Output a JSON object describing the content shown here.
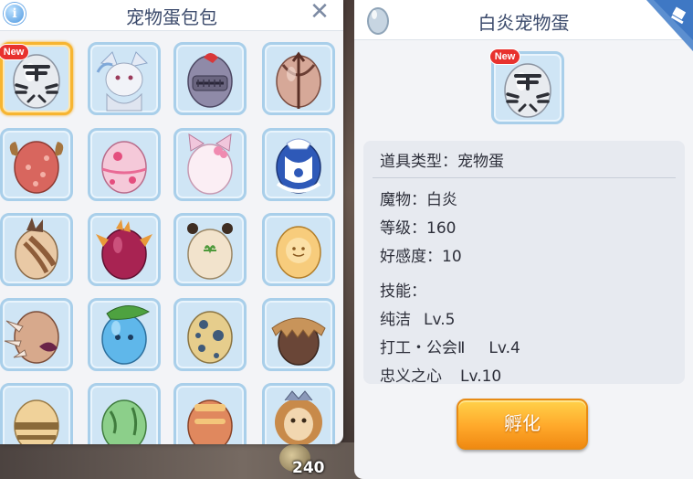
{
  "bag": {
    "title": "宠物蛋包包",
    "info_icon_text": "i",
    "close_icon": "close-icon",
    "new_label": "New",
    "slots": [
      {
        "name": "white-tiger-egg",
        "selected": true,
        "is_new": true
      },
      {
        "name": "fox-creature"
      },
      {
        "name": "knight-helmet-egg"
      },
      {
        "name": "arrow-egg"
      },
      {
        "name": "pink-flower-egg"
      },
      {
        "name": "sakura-egg"
      },
      {
        "name": "cat-ear-egg"
      },
      {
        "name": "blue-maid-egg"
      },
      {
        "name": "brown-spike-egg"
      },
      {
        "name": "red-dragon-egg"
      },
      {
        "name": "bear-sprout-egg"
      },
      {
        "name": "smiley-egg"
      },
      {
        "name": "horned-egg"
      },
      {
        "name": "blue-leaf-egg"
      },
      {
        "name": "spotted-egg"
      },
      {
        "name": "hair-egg"
      },
      {
        "name": "striped-egg"
      },
      {
        "name": "green-egg"
      },
      {
        "name": "red-pattern-egg"
      },
      {
        "name": "lion-creature"
      }
    ]
  },
  "background": {
    "number": "240"
  },
  "detail": {
    "title": "白炎宠物蛋",
    "new_label": "New",
    "item_type": "道具类型：宠物蛋",
    "monster": "魔物：白炎",
    "level": "等级：160",
    "affinity": "好感度：10",
    "skills_label": "技能：",
    "skills": [
      {
        "name": "纯洁",
        "level": "Lv.5"
      },
      {
        "name": "打工・公会Ⅱ",
        "level": "Lv.4"
      },
      {
        "name": "忠义之心",
        "level": "Lv.10"
      }
    ],
    "hatch_button": "孵化"
  },
  "colors": {
    "panel_bg": "#f3f4f7",
    "slot_bg": "#cfe5f5",
    "slot_border": "#a9cfea",
    "selected_border": "#f7b531",
    "title_text": "#3c4b6c",
    "new_badge": "#e8322e",
    "button_orange": "#ffa82a"
  }
}
